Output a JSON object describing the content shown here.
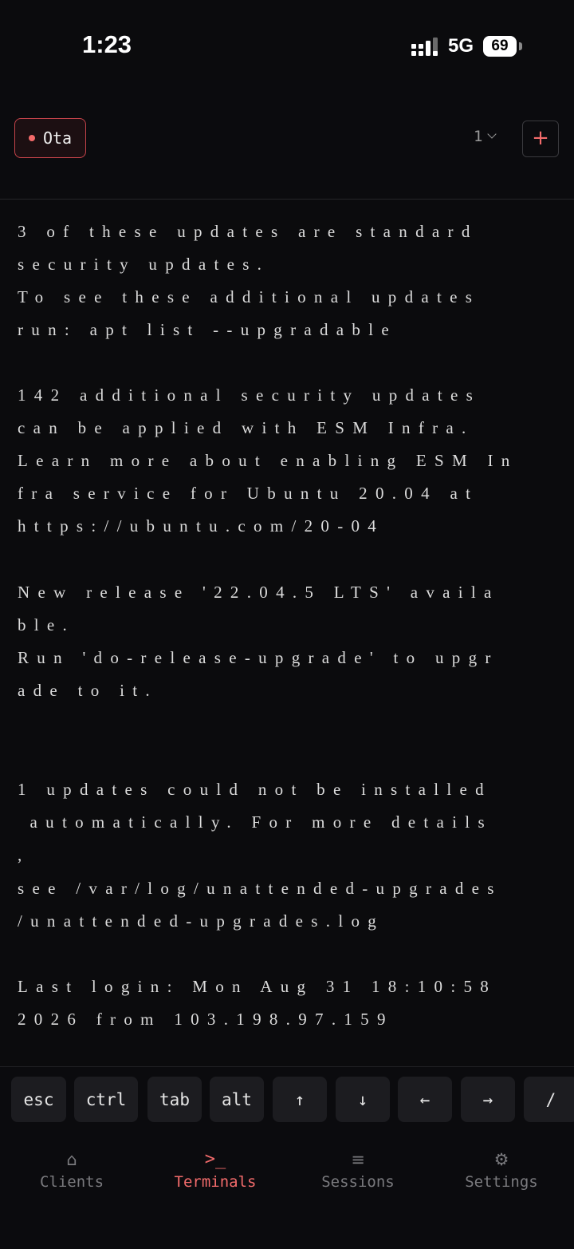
{
  "status_bar": {
    "time": "1:23",
    "network": "5G",
    "battery": "69"
  },
  "topbar": {
    "tab_label": "Ota",
    "window_index": "1",
    "add_label": "+"
  },
  "terminal": {
    "lines": [
      "3 of these updates are standard",
      "security updates.",
      "To see these additional updates",
      "run: apt list --upgradable",
      "",
      "142 additional security updates",
      "can be applied with ESM Infra.",
      "Learn more about enabling ESM In",
      "fra service for Ubuntu 20.04 at",
      "https://ubuntu.com/20-04",
      "",
      "New release '22.04.5 LTS' availa",
      "ble.",
      "Run 'do-release-upgrade' to upgr",
      "ade to it.",
      "",
      "",
      "1 updates could not be installed",
      " automatically. For more details",
      ",",
      "see /var/log/unattended-upgrades",
      "/unattended-upgrades.log",
      "",
      "Last login: Mon Aug 31 18:10:58",
      "2026 from 103.198.97.159"
    ]
  },
  "extra_keys": [
    "esc",
    "ctrl",
    "tab",
    "alt",
    "↑",
    "↓",
    "←",
    "→",
    "/"
  ],
  "nav": {
    "items": [
      {
        "label": "Clients",
        "icon": "⌂",
        "icon_name": "home-icon"
      },
      {
        "label": "Terminals",
        "icon": ">_",
        "icon_name": "terminal-icon"
      },
      {
        "label": "Sessions",
        "icon": "≡",
        "icon_name": "list-icon"
      },
      {
        "label": "Settings",
        "icon": "⚙",
        "icon_name": "gear-icon"
      }
    ],
    "active": "Terminals"
  },
  "colors": {
    "background": "#0b0b0d",
    "accent": "#f26b6b",
    "text": "#dcdcdc",
    "muted": "#7a7a7e"
  }
}
